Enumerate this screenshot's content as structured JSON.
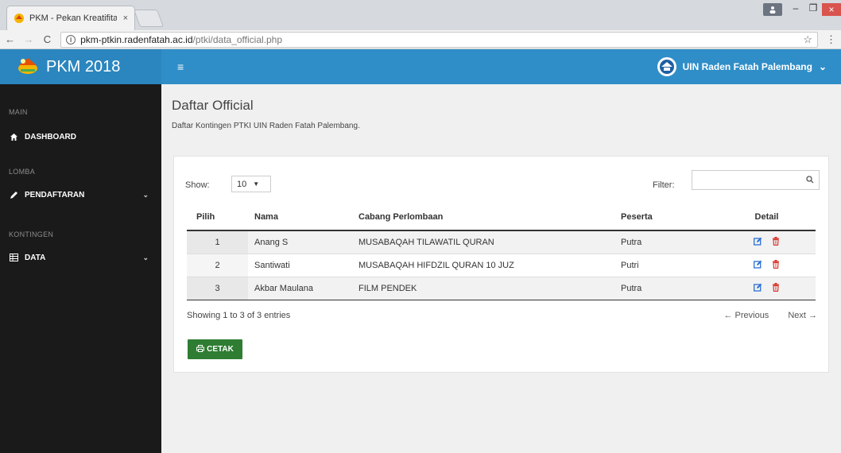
{
  "browser": {
    "tab_title": "PKM - Pekan Kreatifitas Si",
    "tab_close": "×",
    "url_host": "pkm-ptkin.radenfatah.ac.id",
    "url_path": "/ptki/data_official.php"
  },
  "header": {
    "brand": "PKM 2018",
    "menu_icon": "≡",
    "user": "UIN Raden Fatah Palembang",
    "user_caret": "⌄"
  },
  "sidebar": {
    "sections": [
      {
        "title": "MAIN",
        "items": [
          {
            "label": "DASHBOARD",
            "icon": "home-icon"
          }
        ]
      },
      {
        "title": "LOMBA",
        "items": [
          {
            "label": "PENDAFTARAN",
            "icon": "pencil-icon",
            "caret": "⌄"
          }
        ]
      },
      {
        "title": "KONTINGEN",
        "items": [
          {
            "label": "DATA",
            "icon": "table-icon",
            "caret": "⌄"
          }
        ]
      }
    ]
  },
  "page": {
    "title": "Daftar Official",
    "subtitle": "Daftar Kontingen PTKI UIN Raden Fatah Palembang."
  },
  "table_controls": {
    "show_label": "Show:",
    "show_value": "10",
    "filter_label": "Filter:",
    "filter_value": ""
  },
  "table": {
    "headers": [
      "Pilih",
      "Nama",
      "Cabang Perlombaan",
      "Peserta",
      "Detail"
    ],
    "rows": [
      {
        "no": "1",
        "nama": "Anang S",
        "cabang": "MUSABAQAH TILAWATIL QURAN",
        "peserta": "Putra"
      },
      {
        "no": "2",
        "nama": "Santiwati",
        "cabang": "MUSABAQAH HIFDZIL QURAN 10 JUZ",
        "peserta": "Putri"
      },
      {
        "no": "3",
        "nama": "Akbar Maulana",
        "cabang": "FILM PENDEK",
        "peserta": "Putra"
      }
    ]
  },
  "footer": {
    "info": "Showing 1 to 3 of 3 entries",
    "previous": "← Previous",
    "next": "Next →",
    "print_button": "CETAK"
  },
  "colors": {
    "header_blue": "#2f8ec8",
    "sidebar_bg": "#1a1a1a",
    "print_green": "#2e7d32",
    "edit_blue": "#2a6fd6",
    "delete_red": "#d9342b"
  }
}
